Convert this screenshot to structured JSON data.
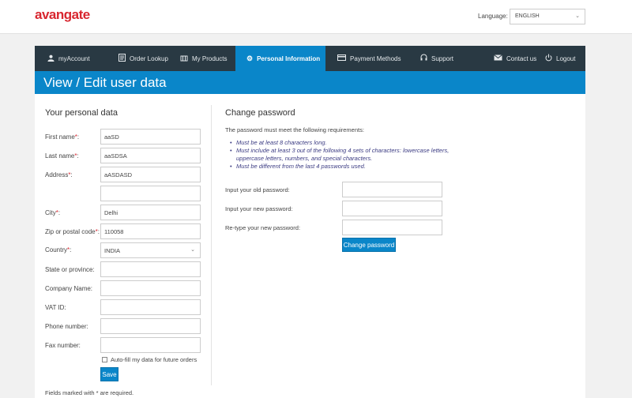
{
  "brand": {
    "logo_text": "avangate",
    "accent": "#0a86c9",
    "brand_red": "#d8262f",
    "nav_bg": "#293943"
  },
  "language": {
    "label": "Language:",
    "value": "ENGLISH"
  },
  "nav": {
    "items": [
      {
        "label": "myAccount",
        "icon": "user-icon"
      },
      {
        "label": "Order Lookup",
        "icon": "document-icon"
      },
      {
        "label": "My Products",
        "icon": "cart-icon"
      },
      {
        "label": "Personal Information",
        "icon": "gear-icon",
        "active": true
      },
      {
        "label": "Payment Methods",
        "icon": "credit-card-icon"
      },
      {
        "label": "Support",
        "icon": "headset-icon"
      },
      {
        "label": "Contact us",
        "icon": "envelope-icon"
      },
      {
        "label": "Logout",
        "icon": "power-icon"
      }
    ]
  },
  "page_title": "View / Edit user data",
  "personal": {
    "title": "Your personal data",
    "fields": [
      {
        "label": "First name",
        "required": true,
        "value": "aaSD"
      },
      {
        "label": "Last name",
        "required": true,
        "value": "aaSDSA"
      },
      {
        "label": "Address",
        "required": true,
        "value": "aASDASD"
      },
      {
        "label": "",
        "required": false,
        "value": ""
      },
      {
        "label": "City",
        "required": true,
        "value": "Delhi"
      },
      {
        "label": "Zip or postal code",
        "required": true,
        "value": "110058"
      },
      {
        "label": "Country",
        "required": true,
        "value": "INDIA"
      },
      {
        "label": "State or province:",
        "required": false,
        "value": ""
      },
      {
        "label": "Company Name:",
        "required": false,
        "value": ""
      },
      {
        "label": "VAT ID:",
        "required": false,
        "value": ""
      },
      {
        "label": "Phone number:",
        "required": false,
        "value": ""
      },
      {
        "label": "Fax number:",
        "required": false,
        "value": ""
      }
    ],
    "autofill_label": "Auto-fill my data for future orders",
    "save_label": "Save",
    "required_note": "Fields marked with * are required."
  },
  "password": {
    "title": "Change password",
    "intro": "The password must meet the following requirements:",
    "requirements": [
      "Must be at least 8 characters long.",
      "Must include at least 3 out of the following 4 sets of characters: lowercase letters, uppercase letters, numbers, and special characters.",
      "Must be different from the last 4 passwords used."
    ],
    "old_label": "Input your old password:",
    "new_label": "Input your new password:",
    "retype_label": "Re-type your new password:",
    "button_label": "Change password"
  }
}
